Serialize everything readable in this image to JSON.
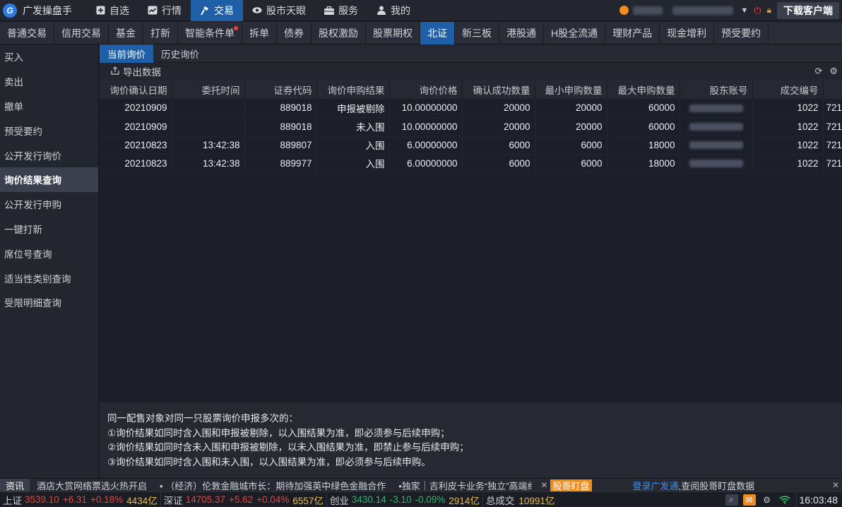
{
  "app": {
    "name": "广发操盘手",
    "logo_letter": "G"
  },
  "top_nav": [
    {
      "label": "自选",
      "icon": "plus-square-icon"
    },
    {
      "label": "行情",
      "icon": "chart-icon"
    },
    {
      "label": "交易",
      "icon": "hammer-icon"
    },
    {
      "label": "股市天眼",
      "icon": "eye-icon"
    },
    {
      "label": "服务",
      "icon": "briefcase-icon"
    },
    {
      "label": "我的",
      "icon": "person-icon"
    }
  ],
  "top_nav_active": "交易",
  "download_label": "下载客户端",
  "sub_tabs": [
    "普通交易",
    "信用交易",
    "基金",
    "打新",
    "智能条件单",
    "拆单",
    "债券",
    "股权激励",
    "股票期权",
    "北证",
    "新三板",
    "港股通",
    "H股全流通",
    "理财产品",
    "现金增利",
    "预受要约"
  ],
  "sub_tab_active": "北证",
  "sidebar": [
    "买入",
    "卖出",
    "撤单",
    "预受要约",
    "公开发行询价",
    "询价结果查询",
    "公开发行申购",
    "一键打新",
    "席位号查询",
    "适当性类别查询",
    "受限明细查询"
  ],
  "sidebar_active": "询价结果查询",
  "main_tabs": [
    "当前询价",
    "历史询价"
  ],
  "main_tab_active": "当前询价",
  "export_label": "导出数据",
  "table": {
    "columns": [
      "询价确认日期",
      "委托时间",
      "证券代码",
      "询价申购结果",
      "询价价格",
      "确认成功数量",
      "最小申购数量",
      "最大申购数量",
      "股东账号",
      "成交编号",
      ""
    ],
    "rows": [
      [
        "20210909",
        "",
        "889018",
        "申报被剔除",
        "10.00000000",
        "20000",
        "20000",
        "60000",
        "",
        "1022",
        "721"
      ],
      [
        "20210909",
        "",
        "889018",
        "未入围",
        "10.00000000",
        "20000",
        "20000",
        "60000",
        "",
        "1022",
        "721"
      ],
      [
        "20210823",
        "13:42:38",
        "889807",
        "入围",
        "6.00000000",
        "6000",
        "6000",
        "18000",
        "",
        "1022",
        "721"
      ],
      [
        "20210823",
        "13:42:38",
        "889977",
        "入围",
        "6.00000000",
        "6000",
        "6000",
        "18000",
        "",
        "1022",
        "721"
      ]
    ]
  },
  "notes": [
    "同一配售对象对同一只股票询价申报多次的：",
    "①询价结果如同时含入围和申报被剔除，以入围结果为准，即必须参与后续申购；",
    "②询价结果如同时含未入围和申报被剔除，以未入围结果为准，即禁止参与后续申购；",
    "③询价结果如同时含入围和未入围，以入围结果为准，即必须参与后续申购。"
  ],
  "news": {
    "label": "资讯",
    "items": [
      "酒店大赏网络票选火热开启",
      "• （经济）伦敦金融城市长：期待加强英中绿色金融合作",
      "•独家｜吉利皮卡业务“独立”高端纟"
    ],
    "badge": "股哥盯盘",
    "login_link": "登录广发通",
    "login_tail": ",查阅股哥盯盘数据"
  },
  "indices": [
    {
      "name": "上证",
      "value": "3539.10",
      "change": "+6.31",
      "pct": "+0.18%",
      "vol": "4434亿",
      "dir": "up"
    },
    {
      "name": "深证",
      "value": "14705.37",
      "change": "+5.62",
      "pct": "+0.04%",
      "vol": "6557亿",
      "dir": "up"
    },
    {
      "name": "创业",
      "value": "3430.14",
      "change": "-3.10",
      "pct": "-0.09%",
      "vol": "2914亿",
      "dir": "down"
    }
  ],
  "total_turnover": {
    "label": "总成交",
    "value": "10991亿"
  },
  "clock": "16:03:48",
  "colors": {
    "accent": "#1f5fa8",
    "up": "#e8413c",
    "down": "#2fb56a",
    "orange": "#f08c1a"
  }
}
